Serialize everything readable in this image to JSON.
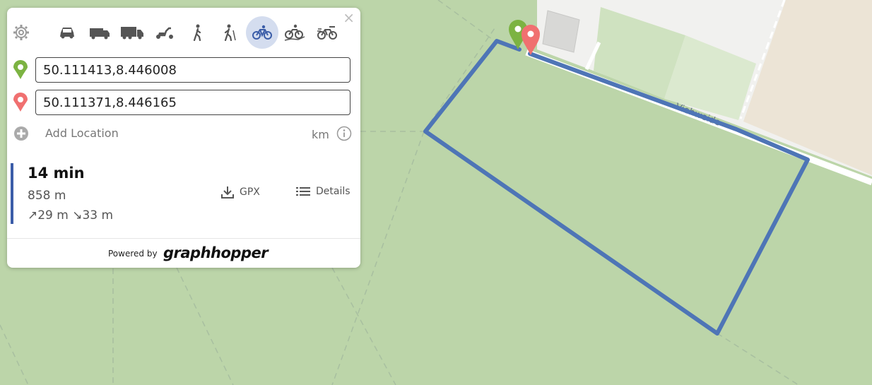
{
  "map": {
    "street_label": "Viehweide",
    "route_color": "#4e75b6"
  },
  "panel": {
    "close_label": "×",
    "profiles": [
      {
        "name": "car",
        "icon": "car-icon"
      },
      {
        "name": "small-truck",
        "icon": "van-icon"
      },
      {
        "name": "truck",
        "icon": "truck-icon"
      },
      {
        "name": "scooter",
        "icon": "scooter-icon"
      },
      {
        "name": "foot",
        "icon": "walk-icon"
      },
      {
        "name": "hike",
        "icon": "hike-icon"
      },
      {
        "name": "bike",
        "icon": "bike-icon",
        "active": true
      },
      {
        "name": "mtb",
        "icon": "mtb-icon"
      },
      {
        "name": "racingbike",
        "icon": "racingbike-icon"
      }
    ],
    "start": {
      "value": "50.111413,8.446008",
      "marker_color": "#7cb342"
    },
    "end": {
      "value": "50.111371,8.446165",
      "marker_color": "#f07070"
    },
    "add_location_label": "Add Location",
    "units_label": "km"
  },
  "route": {
    "time": "14 min",
    "distance": "858 m",
    "elevation": "↗29 m ↘33 m",
    "gpx_label": "GPX",
    "details_label": "Details"
  },
  "footer": {
    "powered_by": "Powered by",
    "brand": "graphhopper"
  }
}
